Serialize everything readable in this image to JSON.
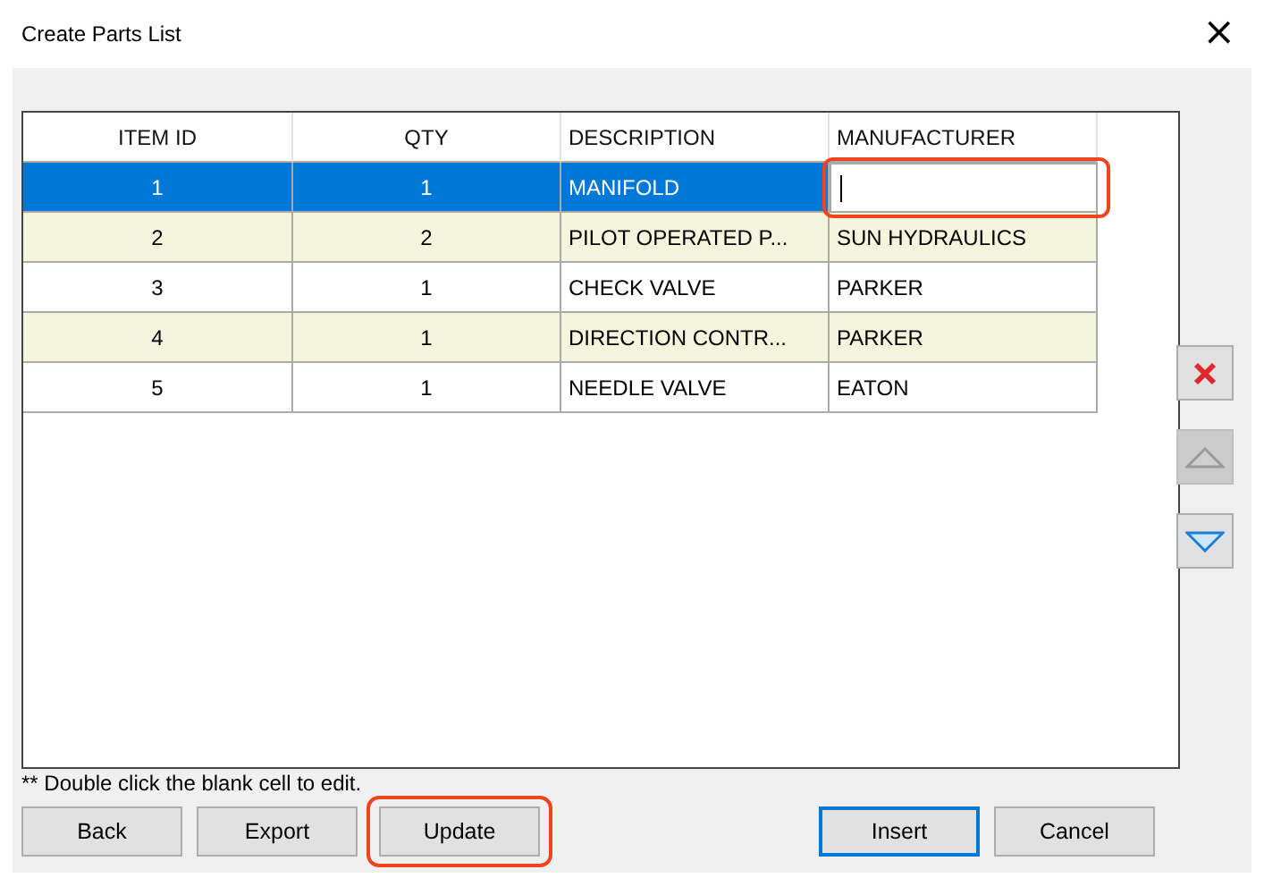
{
  "window": {
    "title": "Create Parts List",
    "close": "×"
  },
  "table": {
    "columns": [
      "ITEM ID",
      "QTY",
      "DESCRIPTION",
      "MANUFACTURER"
    ],
    "rows": [
      {
        "cells": [
          "1",
          "1",
          "MANIFOLD"
        ],
        "selected": true,
        "editing": true,
        "highlighted": true
      },
      {
        "cells": [
          "2",
          "2",
          "PILOT OPERATED P...",
          "SUN HYDRAULICS"
        ],
        "selected": false,
        "editing": false,
        "highlighted": false
      },
      {
        "cells": [
          "3",
          "1",
          "CHECK VALVE",
          "PARKER"
        ],
        "selected": false,
        "editing": false,
        "highlighted": false
      },
      {
        "cells": [
          "4",
          "1",
          "DIRECTION CONTR...",
          "PARKER"
        ],
        "selected": false,
        "editing": false,
        "highlighted": false
      },
      {
        "cells": [
          "5",
          "1",
          "NEEDLE VALVE",
          "EATON"
        ],
        "selected": false,
        "editing": false,
        "highlighted": false
      }
    ]
  },
  "side_buttons": [
    {
      "kind": "delete",
      "disabled": false
    },
    {
      "kind": "up",
      "disabled": true
    },
    {
      "kind": "down",
      "disabled": false
    }
  ],
  "note": "** Double click the blank cell to edit.",
  "left_buttons": [
    {
      "label": "Back",
      "default": false,
      "highlighted": false
    },
    {
      "label": "Export",
      "default": false,
      "highlighted": false
    },
    {
      "label": "Update",
      "default": false,
      "highlighted": true
    }
  ],
  "right_buttons": [
    {
      "label": "Insert",
      "default": true,
      "highlighted": false
    },
    {
      "label": "Cancel",
      "default": false,
      "highlighted": false
    }
  ]
}
